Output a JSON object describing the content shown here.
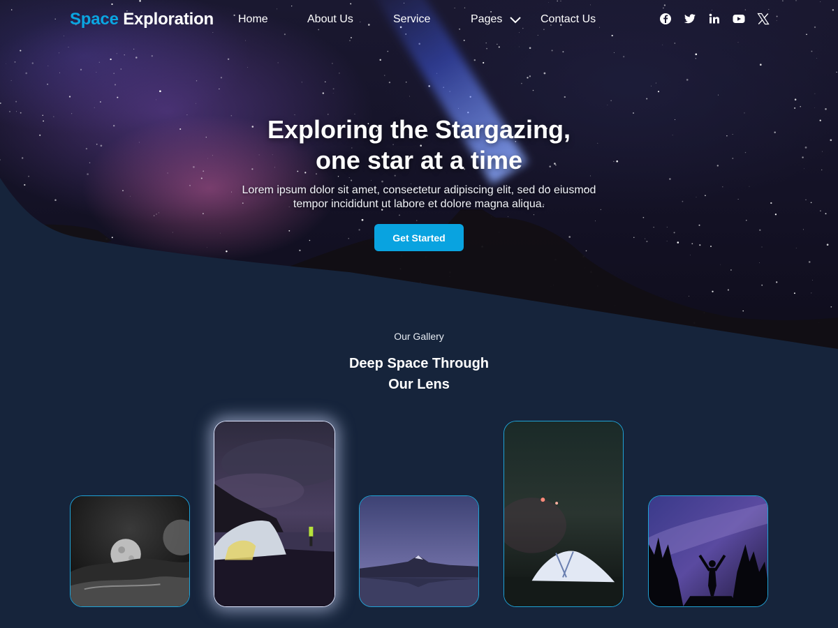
{
  "nav": {
    "logo_part1": "Space",
    "logo_part2": "Exploration",
    "links": [
      "Home",
      "About Us",
      "Service",
      "Pages",
      "Contact Us"
    ],
    "social_icons": [
      "facebook-icon",
      "twitter-icon",
      "linkedin-icon",
      "youtube-icon",
      "x-icon"
    ]
  },
  "hero": {
    "title_line1": "Exploring the Stargazing,",
    "title_line2": "one star at a time",
    "subtitle_line1": "Lorem ipsum dolor sit amet, consectetur adipiscing elit, sed do eiusmod",
    "subtitle_line2": "tempor incididunt ut labore et dolore magna aliqua.",
    "cta_label": "Get Started"
  },
  "gallery": {
    "eyebrow": "Our Gallery",
    "title_line1": "Deep Space Through",
    "title_line2": "Our Lens",
    "images": [
      "moon-landscape-photo",
      "tent-by-lake-photo",
      "mountain-lake-dusk-photo",
      "tent-under-stars-photo",
      "person-under-milky-way-photo"
    ]
  },
  "colors": {
    "accent": "#0aa6e2",
    "background": "#16243b",
    "card_border": "#1fa3d6"
  }
}
